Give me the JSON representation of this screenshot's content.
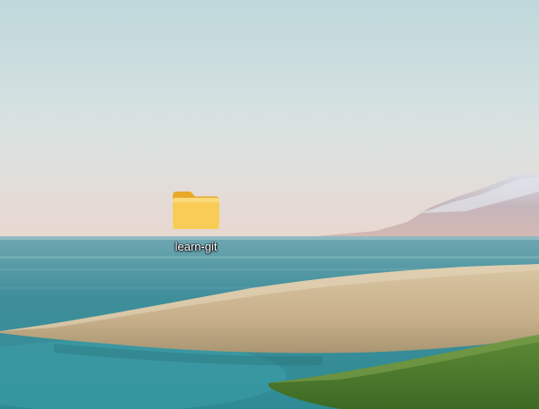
{
  "desktop": {
    "icons": [
      {
        "label": "learn-git",
        "icon": "folder-icon",
        "icon_color": "#F7C948"
      }
    ]
  },
  "wallpaper": {
    "sky_color": "#C9DDDD",
    "water_color": "#4E9FA8",
    "grass_color": "#D6C29E",
    "green_grass_color": "#4F7A2E",
    "mountain_color": "#C7B6B8"
  }
}
